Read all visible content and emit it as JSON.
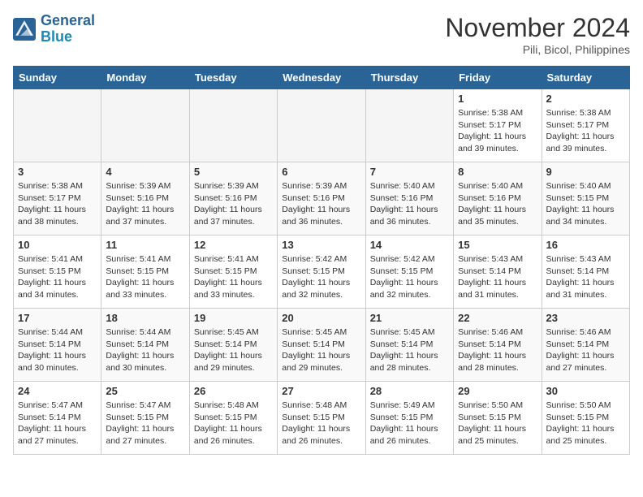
{
  "header": {
    "logo_line1": "General",
    "logo_line2": "Blue",
    "month": "November 2024",
    "location": "Pili, Bicol, Philippines"
  },
  "weekdays": [
    "Sunday",
    "Monday",
    "Tuesday",
    "Wednesday",
    "Thursday",
    "Friday",
    "Saturday"
  ],
  "weeks": [
    [
      {
        "day": "",
        "info": ""
      },
      {
        "day": "",
        "info": ""
      },
      {
        "day": "",
        "info": ""
      },
      {
        "day": "",
        "info": ""
      },
      {
        "day": "",
        "info": ""
      },
      {
        "day": "1",
        "info": "Sunrise: 5:38 AM\nSunset: 5:17 PM\nDaylight: 11 hours\nand 39 minutes."
      },
      {
        "day": "2",
        "info": "Sunrise: 5:38 AM\nSunset: 5:17 PM\nDaylight: 11 hours\nand 39 minutes."
      }
    ],
    [
      {
        "day": "3",
        "info": "Sunrise: 5:38 AM\nSunset: 5:17 PM\nDaylight: 11 hours\nand 38 minutes."
      },
      {
        "day": "4",
        "info": "Sunrise: 5:39 AM\nSunset: 5:16 PM\nDaylight: 11 hours\nand 37 minutes."
      },
      {
        "day": "5",
        "info": "Sunrise: 5:39 AM\nSunset: 5:16 PM\nDaylight: 11 hours\nand 37 minutes."
      },
      {
        "day": "6",
        "info": "Sunrise: 5:39 AM\nSunset: 5:16 PM\nDaylight: 11 hours\nand 36 minutes."
      },
      {
        "day": "7",
        "info": "Sunrise: 5:40 AM\nSunset: 5:16 PM\nDaylight: 11 hours\nand 36 minutes."
      },
      {
        "day": "8",
        "info": "Sunrise: 5:40 AM\nSunset: 5:16 PM\nDaylight: 11 hours\nand 35 minutes."
      },
      {
        "day": "9",
        "info": "Sunrise: 5:40 AM\nSunset: 5:15 PM\nDaylight: 11 hours\nand 34 minutes."
      }
    ],
    [
      {
        "day": "10",
        "info": "Sunrise: 5:41 AM\nSunset: 5:15 PM\nDaylight: 11 hours\nand 34 minutes."
      },
      {
        "day": "11",
        "info": "Sunrise: 5:41 AM\nSunset: 5:15 PM\nDaylight: 11 hours\nand 33 minutes."
      },
      {
        "day": "12",
        "info": "Sunrise: 5:41 AM\nSunset: 5:15 PM\nDaylight: 11 hours\nand 33 minutes."
      },
      {
        "day": "13",
        "info": "Sunrise: 5:42 AM\nSunset: 5:15 PM\nDaylight: 11 hours\nand 32 minutes."
      },
      {
        "day": "14",
        "info": "Sunrise: 5:42 AM\nSunset: 5:15 PM\nDaylight: 11 hours\nand 32 minutes."
      },
      {
        "day": "15",
        "info": "Sunrise: 5:43 AM\nSunset: 5:14 PM\nDaylight: 11 hours\nand 31 minutes."
      },
      {
        "day": "16",
        "info": "Sunrise: 5:43 AM\nSunset: 5:14 PM\nDaylight: 11 hours\nand 31 minutes."
      }
    ],
    [
      {
        "day": "17",
        "info": "Sunrise: 5:44 AM\nSunset: 5:14 PM\nDaylight: 11 hours\nand 30 minutes."
      },
      {
        "day": "18",
        "info": "Sunrise: 5:44 AM\nSunset: 5:14 PM\nDaylight: 11 hours\nand 30 minutes."
      },
      {
        "day": "19",
        "info": "Sunrise: 5:45 AM\nSunset: 5:14 PM\nDaylight: 11 hours\nand 29 minutes."
      },
      {
        "day": "20",
        "info": "Sunrise: 5:45 AM\nSunset: 5:14 PM\nDaylight: 11 hours\nand 29 minutes."
      },
      {
        "day": "21",
        "info": "Sunrise: 5:45 AM\nSunset: 5:14 PM\nDaylight: 11 hours\nand 28 minutes."
      },
      {
        "day": "22",
        "info": "Sunrise: 5:46 AM\nSunset: 5:14 PM\nDaylight: 11 hours\nand 28 minutes."
      },
      {
        "day": "23",
        "info": "Sunrise: 5:46 AM\nSunset: 5:14 PM\nDaylight: 11 hours\nand 27 minutes."
      }
    ],
    [
      {
        "day": "24",
        "info": "Sunrise: 5:47 AM\nSunset: 5:14 PM\nDaylight: 11 hours\nand 27 minutes."
      },
      {
        "day": "25",
        "info": "Sunrise: 5:47 AM\nSunset: 5:15 PM\nDaylight: 11 hours\nand 27 minutes."
      },
      {
        "day": "26",
        "info": "Sunrise: 5:48 AM\nSunset: 5:15 PM\nDaylight: 11 hours\nand 26 minutes."
      },
      {
        "day": "27",
        "info": "Sunrise: 5:48 AM\nSunset: 5:15 PM\nDaylight: 11 hours\nand 26 minutes."
      },
      {
        "day": "28",
        "info": "Sunrise: 5:49 AM\nSunset: 5:15 PM\nDaylight: 11 hours\nand 26 minutes."
      },
      {
        "day": "29",
        "info": "Sunrise: 5:50 AM\nSunset: 5:15 PM\nDaylight: 11 hours\nand 25 minutes."
      },
      {
        "day": "30",
        "info": "Sunrise: 5:50 AM\nSunset: 5:15 PM\nDaylight: 11 hours\nand 25 minutes."
      }
    ]
  ]
}
